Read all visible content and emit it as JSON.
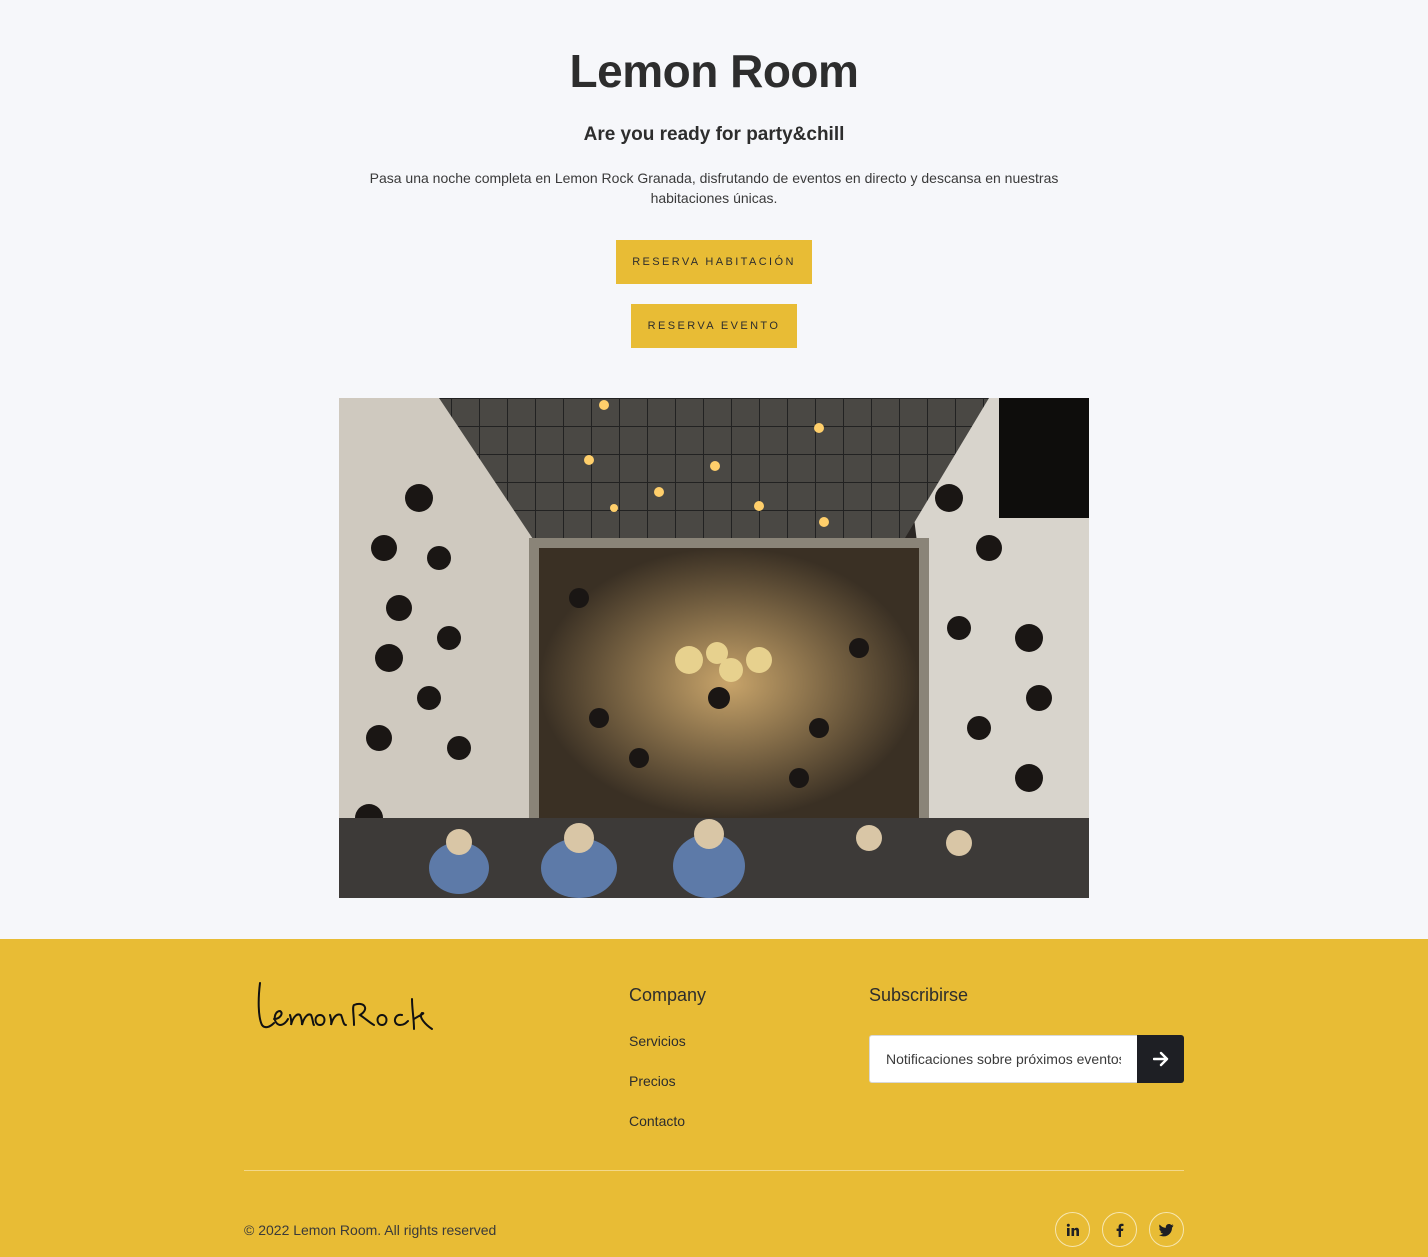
{
  "hero": {
    "title": "Lemon Room",
    "subtitle": "Are you ready for party&chill",
    "description": "Pasa una noche completa en Lemon Rock Granada, disfrutando de eventos en directo y descansa en nuestras habitaciones únicas.",
    "button_room": "RESERVA HABITACIÓN",
    "button_event": "RESERVA EVENTO"
  },
  "footer": {
    "logo_text": "lemonRock",
    "company_title": "Company",
    "links": [
      "Servicios",
      "Precios",
      "Contacto"
    ],
    "subscribe_title": "Subscribirse",
    "subscribe_placeholder": "Notificaciones sobre próximos eventos",
    "copyright": "© 2022 Lemon Room. All rights reserved",
    "social_icons": [
      "linkedin-icon",
      "facebook-icon",
      "twitter-icon"
    ]
  },
  "colors": {
    "accent": "#e8bc35",
    "background": "#f6f7fa",
    "dark": "#1e1f24"
  }
}
